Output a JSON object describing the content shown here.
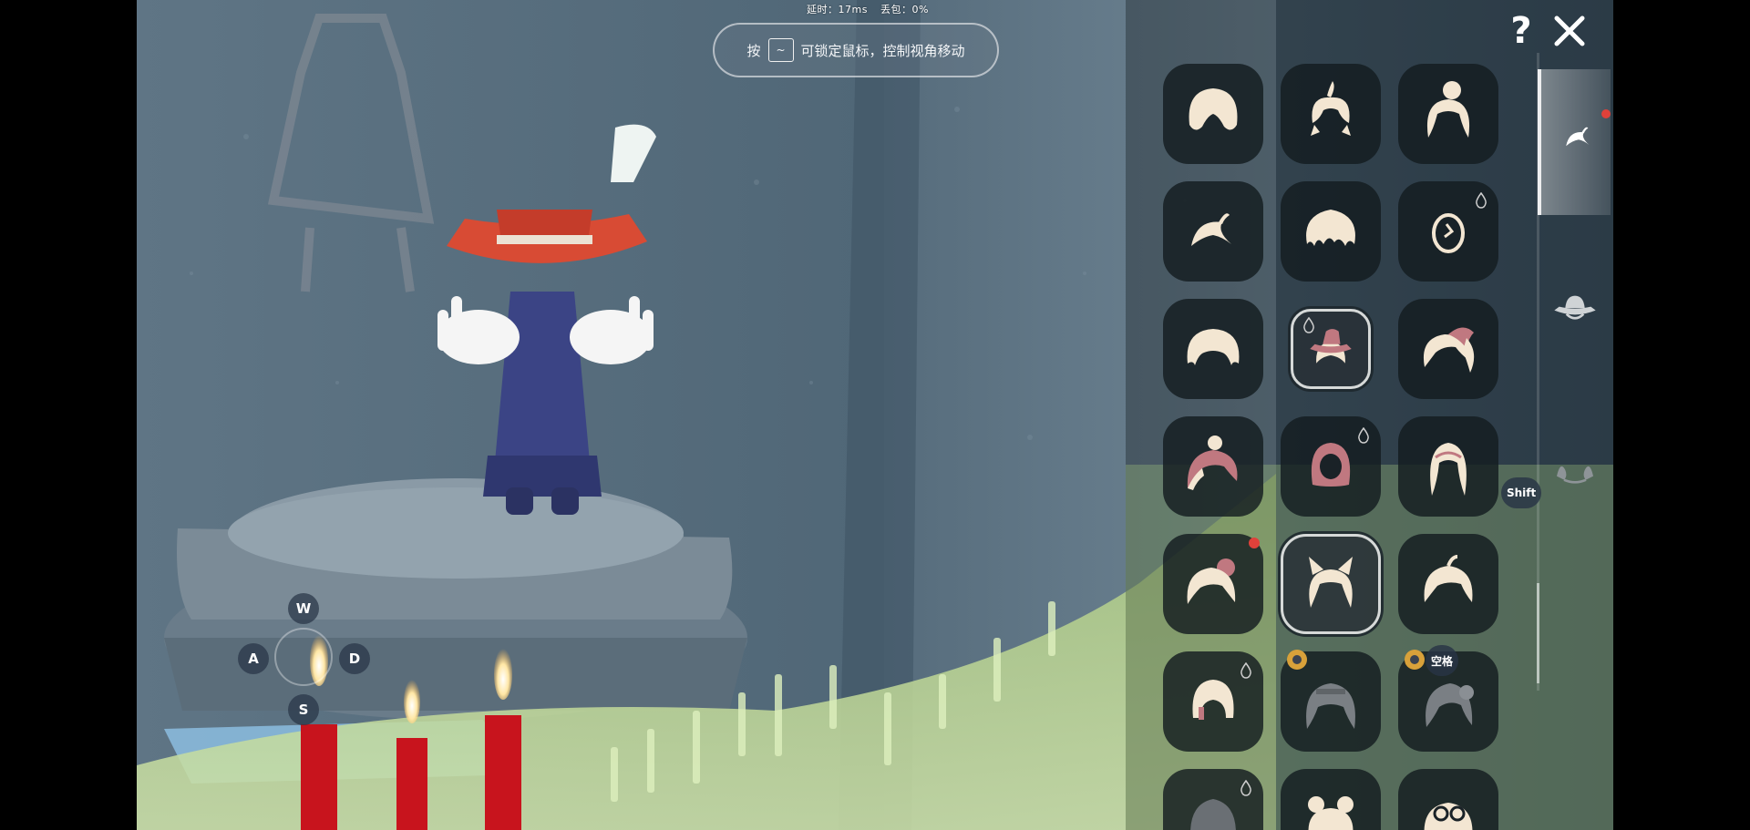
{
  "hud": {
    "latency": "延时：17ms",
    "packet_loss": "丢包：0%"
  },
  "hint": {
    "prefix": "按",
    "key": "~",
    "text": "可锁定鼠标，控制视角移动"
  },
  "movement_keys": {
    "up": "W",
    "left": "A",
    "right": "D",
    "down": "S"
  },
  "top_buttons": {
    "help": "?",
    "close_icon": "close-icon"
  },
  "sidebar_keys": {
    "shift": "Shift",
    "space": "空格"
  },
  "tabs": [
    {
      "name": "hair",
      "icon": "hair-icon",
      "active": true,
      "has_notification": true
    },
    {
      "name": "hat",
      "icon": "hat-icon",
      "active": false,
      "has_notification": false
    },
    {
      "name": "horn",
      "icon": "horn-icon",
      "active": false,
      "has_notification": false
    }
  ],
  "items": [
    {
      "icon": "bob-hair-icon",
      "owned": true
    },
    {
      "icon": "ponytail-hair-icon",
      "owned": true
    },
    {
      "icon": "bun-hair-icon",
      "owned": true
    },
    {
      "icon": "swoop-hair-icon",
      "owned": true
    },
    {
      "icon": "messy-hair-icon",
      "owned": true
    },
    {
      "icon": "egg-hair-icon",
      "owned": true,
      "candle_currency": true
    },
    {
      "icon": "short-hair-icon",
      "owned": true
    },
    {
      "icon": "witch-hat-hair-icon",
      "owned": true,
      "selected": true,
      "candle_currency": true
    },
    {
      "icon": "pink-ponytail-hair-icon",
      "owned": true
    },
    {
      "icon": "pink-bun-hair-icon",
      "owned": true
    },
    {
      "icon": "hood-hair-icon",
      "owned": true,
      "candle_currency": true
    },
    {
      "icon": "long-hair-icon",
      "owned": true
    },
    {
      "icon": "flower-bun-hair-icon",
      "owned": true,
      "has_notification": true
    },
    {
      "icon": "cat-ear-hair-icon",
      "owned": true,
      "selected": true
    },
    {
      "icon": "side-ponytail-hair-icon",
      "owned": true
    },
    {
      "icon": "helmet-hair-icon",
      "owned": true,
      "candle_currency": true
    },
    {
      "icon": "locked-braid-hair-icon",
      "owned": false,
      "season": true
    },
    {
      "icon": "locked-wild-hair-icon",
      "owned": false,
      "season": true
    },
    {
      "icon": "locked-dark-hair-icon",
      "owned": false,
      "candle_currency": true
    },
    {
      "icon": "twin-bun-hair-icon",
      "owned": true
    },
    {
      "icon": "goggle-hair-icon",
      "owned": true
    }
  ]
}
